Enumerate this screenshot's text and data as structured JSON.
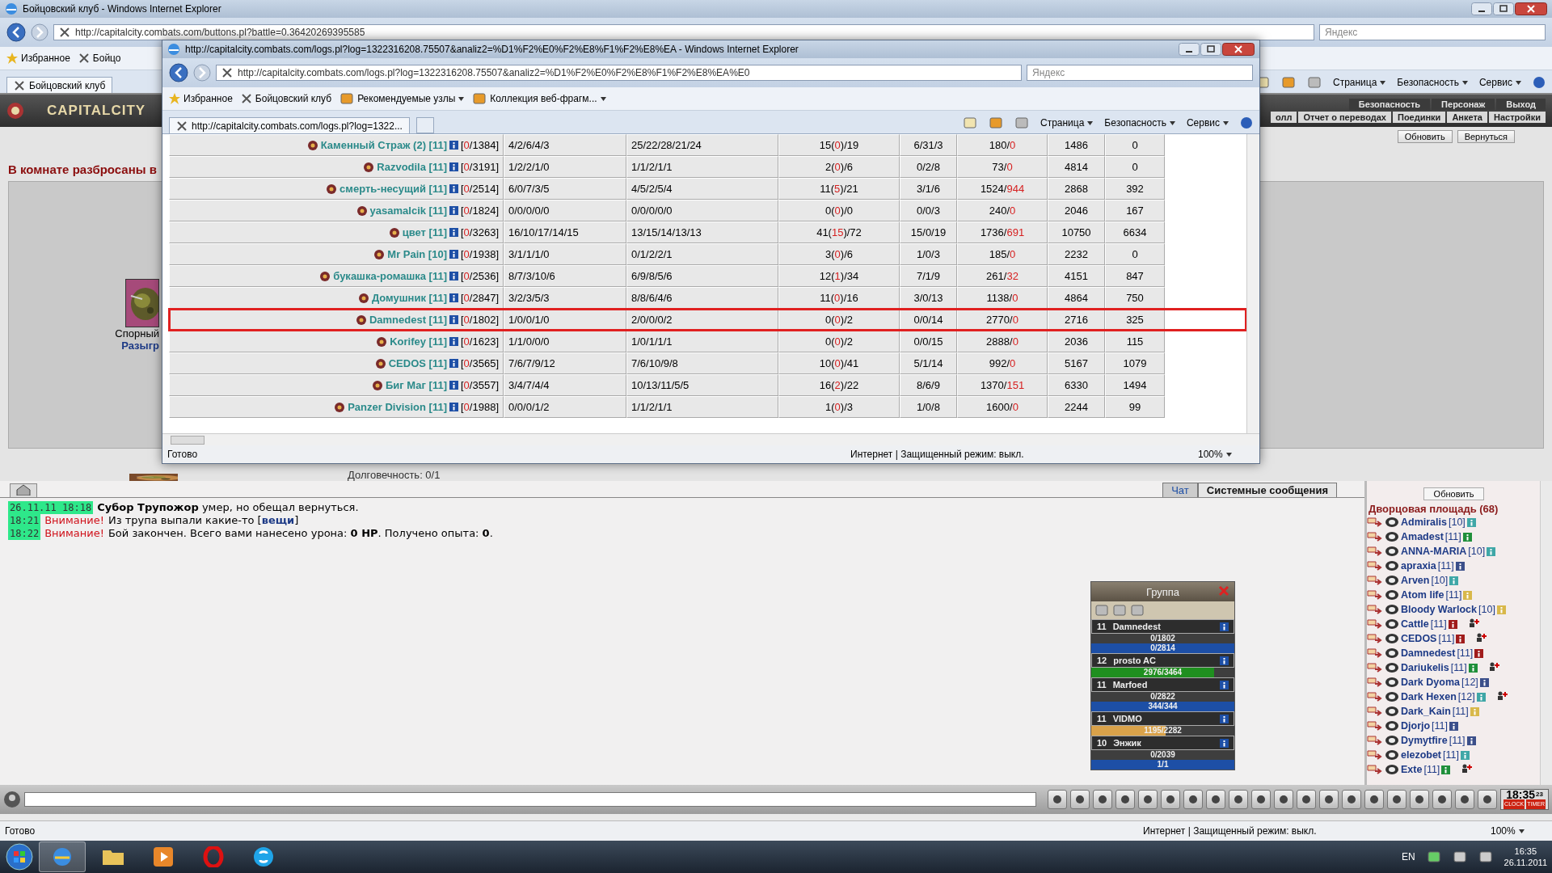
{
  "main_window": {
    "title": "Бойцовский клуб - Windows Internet Explorer",
    "address": "http://capitalcity.combats.com/buttons.pl?battle=0.36420269395585",
    "search_placeholder": "Яндекс",
    "favorites": [
      "Избранное",
      "Бойцо"
    ],
    "tab": "Бойцовский клуб",
    "commands": [
      "Страница",
      "Безопасность",
      "Сервис"
    ],
    "status": "Готово",
    "zone": "Интернет | Защищенный режим: выкл.",
    "zoom": "100%"
  },
  "game": {
    "logo": "CAPITALCITY",
    "menu_top": [
      "Безопасность",
      "Персонаж",
      "Выход"
    ],
    "menu_bottom": [
      "олл",
      "Отчет о переводах",
      "Поединки",
      "Анкета",
      "Настройки"
    ],
    "buttons": [
      "Обновить",
      "Вернуться"
    ],
    "room_notice": "В комнате разбросаны в",
    "item_caption": "Спорный",
    "item_action": "Разыгр",
    "durability": "Долговечность: 0/1"
  },
  "popup": {
    "title": "http://capitalcity.combats.com/logs.pl?log=1322316208.75507&analiz2=%D1%F2%E0%F2%E8%F1%F2%E8%EA - Windows Internet Explorer",
    "address": "http://capitalcity.combats.com/logs.pl?log=1322316208.75507&analiz2=%D1%F2%E0%F2%E8%F1%F2%E8%EA%E0",
    "search_placeholder": "Яндекс",
    "favorites": [
      "Избранное",
      "Бойцовский клуб"
    ],
    "favorite_menus": [
      "Рекомендуемые узлы",
      "Коллекция веб-фрагм..."
    ],
    "tab": "http://capitalcity.combats.com/logs.pl?log=1322...",
    "commands": [
      "Страница",
      "Безопасность",
      "Сервис"
    ],
    "rows": [
      {
        "name": "Каменный Страж (2) [11]",
        "hp": [
          "[",
          "0",
          "/1384]"
        ],
        "column_2": "4/2/6/4/3",
        "column_3": "25/22/28/21/24",
        "column_4": [
          "15(",
          "0",
          ")/19"
        ],
        "column_5": "6/31/3",
        "column_6": [
          "180/",
          "0"
        ],
        "column_7": "1486",
        "column_8": "0",
        "selected": false
      },
      {
        "name": "Razvodila [11]",
        "hp": [
          "[",
          "0",
          "/3191]"
        ],
        "column_2": "1/2/2/1/0",
        "column_3": "1/1/2/1/1",
        "column_4": [
          "2(",
          "0",
          ")/6"
        ],
        "column_5": "0/2/8",
        "column_6": [
          "73/",
          "0"
        ],
        "column_7": "4814",
        "column_8": "0",
        "selected": false
      },
      {
        "name": "смерть-несущий [11]",
        "hp": [
          "[",
          "0",
          "/2514]"
        ],
        "column_2": "6/0/7/3/5",
        "column_3": "4/5/2/5/4",
        "column_4": [
          "11(",
          "5",
          ")/21"
        ],
        "column_5": "3/1/6",
        "column_6": [
          "1524/",
          "944"
        ],
        "column_7": "2868",
        "column_8": "392",
        "selected": false
      },
      {
        "name": "yasamalcik [11]",
        "hp": [
          "[",
          "0",
          "/1824]"
        ],
        "column_2": "0/0/0/0/0",
        "column_3": "0/0/0/0/0",
        "column_4": [
          "0(",
          "0",
          ")/0"
        ],
        "column_5": "0/0/3",
        "column_6": [
          "240/",
          "0"
        ],
        "column_7": "2046",
        "column_8": "167",
        "selected": false
      },
      {
        "name": "цвет [11]",
        "hp": [
          "[",
          "0",
          "/3263]"
        ],
        "column_2": "16/10/17/14/15",
        "column_3": "13/15/14/13/13",
        "column_4": [
          "41(",
          "15",
          ")/72"
        ],
        "column_5": "15/0/19",
        "column_6": [
          "1736/",
          "691"
        ],
        "column_7": "10750",
        "column_8": "6634",
        "selected": false
      },
      {
        "name": "Mr Pain [10]",
        "hp": [
          "[",
          "0",
          "/1938]"
        ],
        "column_2": "3/1/1/1/0",
        "column_3": "0/1/2/2/1",
        "column_4": [
          "3(",
          "0",
          ")/6"
        ],
        "column_5": "1/0/3",
        "column_6": [
          "185/",
          "0"
        ],
        "column_7": "2232",
        "column_8": "0",
        "selected": false
      },
      {
        "name": "букашка-ромашка [11]",
        "hp": [
          "[",
          "0",
          "/2536]"
        ],
        "column_2": "8/7/3/10/6",
        "column_3": "6/9/8/5/6",
        "column_4": [
          "12(",
          "1",
          ")/34"
        ],
        "column_5": "7/1/9",
        "column_6": [
          "261/",
          "32"
        ],
        "column_7": "4151",
        "column_8": "847",
        "selected": false
      },
      {
        "name": "Домушник [11]",
        "hp": [
          "[",
          "0",
          "/2847]"
        ],
        "column_2": "3/2/3/5/3",
        "column_3": "8/8/6/4/6",
        "column_4": [
          "11(",
          "0",
          ")/16"
        ],
        "column_5": "3/0/13",
        "column_6": [
          "1138/",
          "0"
        ],
        "column_7": "4864",
        "column_8": "750",
        "selected": false
      },
      {
        "name": "Damnedest [11]",
        "hp": [
          "[",
          "0",
          "/1802]"
        ],
        "column_2": "1/0/0/1/0",
        "column_3": "2/0/0/0/2",
        "column_4": [
          "0(",
          "0",
          ")/2"
        ],
        "column_5": "0/0/14",
        "column_6": [
          "2770/",
          "0"
        ],
        "column_7": "2716",
        "column_8": "325",
        "selected": true
      },
      {
        "name": "Korifey [11]",
        "hp": [
          "[",
          "0",
          "/1623]"
        ],
        "column_2": "1/1/0/0/0",
        "column_3": "1/0/1/1/1",
        "column_4": [
          "0(",
          "0",
          ")/2"
        ],
        "column_5": "0/0/15",
        "column_6": [
          "2888/",
          "0"
        ],
        "column_7": "2036",
        "column_8": "115",
        "selected": false
      },
      {
        "name": "CEDOS [11]",
        "hp": [
          "[",
          "0",
          "/3565]"
        ],
        "column_2": "7/6/7/9/12",
        "column_3": "7/6/10/9/8",
        "column_4": [
          "10(",
          "0",
          ")/41"
        ],
        "column_5": "5/1/14",
        "column_6": [
          "992/",
          "0"
        ],
        "column_7": "5167",
        "column_8": "1079",
        "selected": false
      },
      {
        "name": "Биг Маг [11]",
        "hp": [
          "[",
          "0",
          "/3557]"
        ],
        "column_2": "3/4/7/4/4",
        "column_3": "10/13/11/5/5",
        "column_4": [
          "16(",
          "2",
          ")/22"
        ],
        "column_5": "8/6/9",
        "column_6": [
          "1370/",
          "151"
        ],
        "column_7": "6330",
        "column_8": "1494",
        "selected": false
      },
      {
        "name": "Panzer Division [11]",
        "hp": [
          "[",
          "0",
          "/1988]"
        ],
        "column_2": "0/0/0/1/2",
        "column_3": "1/1/2/1/1",
        "column_4": [
          "1(",
          "0",
          ")/3"
        ],
        "column_5": "1/0/8",
        "column_6": [
          "1600/",
          "0"
        ],
        "column_7": "2244",
        "column_8": "99",
        "selected": false
      }
    ],
    "status": "Готово",
    "zone": "Интернет | Защищенный режим: выкл.",
    "zoom": "100%"
  },
  "chat": {
    "tabs": [
      {
        "label": "Чат",
        "selected": false
      },
      {
        "label": "Системные сообщения",
        "selected": true
      }
    ],
    "messages": [
      {
        "time": "26.11.11 18:18",
        "text": "**Субор Трупожор** умер, но обещал вернуться."
      },
      {
        "time": "18:21",
        "alert": "Внимание!",
        "text": "Из трупа выпали какие-то [",
        "link": "вещи",
        "text_after": "]"
      },
      {
        "time": "18:22",
        "alert": "Внимание!",
        "text": "Бой закончен. Всего вами нанесено урона: **0 HP**. Получено опыта: **0**."
      }
    ]
  },
  "group": {
    "title": "Группа",
    "members": [
      {
        "level": "11",
        "name": "Damnedest",
        "bars": [
          {
            "text": "0/1802",
            "level": 0
          },
          {
            "text": "0/2814",
            "level": 1,
            "color": "#1d4fa6"
          }
        ]
      },
      {
        "level": "12",
        "name": "prosto AC",
        "bars": [
          {
            "text": "2976/3464",
            "level": 0.86,
            "color": "#1f8f1f"
          }
        ]
      },
      {
        "level": "11",
        "name": "Marfoed",
        "bars": [
          {
            "text": "0/2822",
            "level": 0
          },
          {
            "text": "344/344",
            "level": 1,
            "color": "#1d4fa6"
          }
        ]
      },
      {
        "level": "11",
        "name": "VIDMO",
        "bars": [
          {
            "text": "1195/2282",
            "level": 0.52,
            "color": "#d9a24a"
          }
        ]
      },
      {
        "level": "10",
        "name": "Энжик",
        "bars": [
          {
            "text": "0/2039",
            "level": 0
          },
          {
            "text": "1/1",
            "level": 1,
            "color": "#1d4fa6"
          }
        ]
      }
    ]
  },
  "room": {
    "refresh": "Обновить",
    "title": "Дворцовая площадь (68)",
    "users": [
      {
        "name": "Admiralis",
        "level": "[10]",
        "color": "#3fa7a7",
        "invite": false
      },
      {
        "name": "Amadest",
        "level": "[11]",
        "color": "#1f8f3a",
        "invite": false
      },
      {
        "name": "ANNA-MARIA",
        "level": "[10]",
        "color": "#3fa7a7",
        "invite": false
      },
      {
        "name": "apraxia",
        "level": "[11]",
        "color": "#3b4f8a",
        "invite": false
      },
      {
        "name": "Arven",
        "level": "[10]",
        "color": "#3fa7a7",
        "invite": false
      },
      {
        "name": "Atom life",
        "level": "[11]",
        "color": "#d8b84a",
        "invite": false
      },
      {
        "name": "Bloody Warlock",
        "level": "[10]",
        "color": "#d8b84a",
        "invite": false
      },
      {
        "name": "Cattle",
        "level": "[11]",
        "color": "#a01c1c",
        "invite": true
      },
      {
        "name": "CEDOS",
        "level": "[11]",
        "color": "#a01c1c",
        "invite": true
      },
      {
        "name": "Damnedest",
        "level": "[11]",
        "color": "#a01c1c",
        "invite": false
      },
      {
        "name": "Dariukelis",
        "level": "[11]",
        "color": "#1f8f3a",
        "invite": true
      },
      {
        "name": "Dark Dyoma",
        "level": "[12]",
        "color": "#3b4f8a",
        "invite": false
      },
      {
        "name": "Dark Hexen",
        "level": "[12]",
        "color": "#3fa7a7",
        "invite": true
      },
      {
        "name": "Dark_Kain",
        "level": "[11]",
        "color": "#d8b84a",
        "invite": false
      },
      {
        "name": "Djorjo",
        "level": "[11]",
        "color": "#3b4f8a",
        "invite": false
      },
      {
        "name": "Dymytfire",
        "level": "[11]",
        "color": "#3b4f8a",
        "invite": false
      },
      {
        "name": "elezobet",
        "level": "[11]",
        "color": "#3fa7a7",
        "invite": false
      },
      {
        "name": "Exte",
        "level": "[11]",
        "color": "#1f8f3a",
        "invite": true
      }
    ]
  },
  "clock": {
    "time": "18:35",
    "seconds": "23",
    "labels": [
      "CLOCK",
      "TIMER"
    ]
  },
  "taskbar": {
    "language": "EN",
    "time": "16:35",
    "date": "26.11.2011"
  }
}
